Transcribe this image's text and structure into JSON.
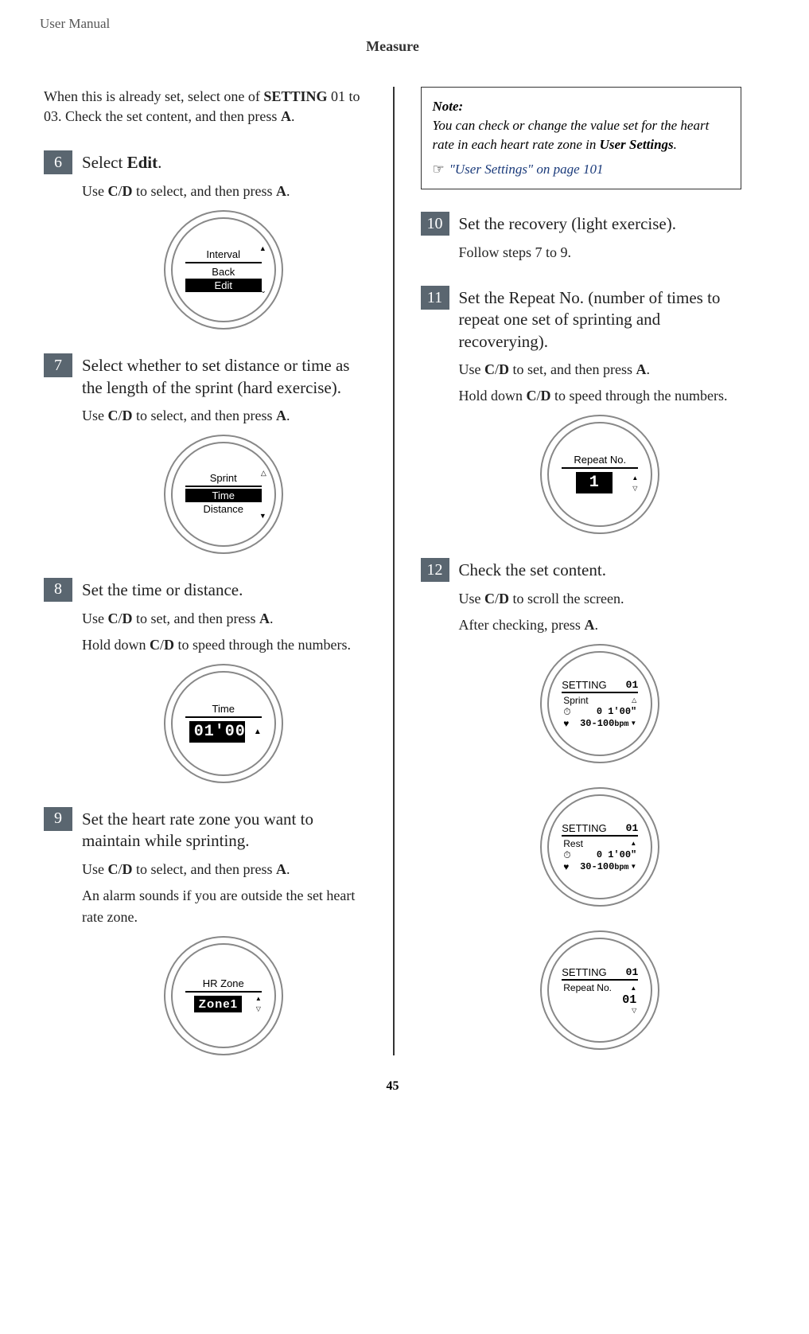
{
  "header": "User Manual",
  "section": "Measure",
  "page_number": "45",
  "intro": {
    "pre": "When this is already set, select one of ",
    "bold1": "SETTING",
    "mid": " 01 to 03. Check the set content, and then press ",
    "bold2": "A",
    "end": "."
  },
  "steps": {
    "s6": {
      "num": "6",
      "title_pre": "Select ",
      "title_bold": "Edit",
      "title_post": ".",
      "body1_pre": "Use ",
      "body1_b1": "C",
      "body1_slash": "/",
      "body1_b2": "D",
      "body1_mid": " to select, and then press ",
      "body1_b3": "A",
      "body1_end": "."
    },
    "s7": {
      "num": "7",
      "title": "Select whether to set distance or time as the length of the sprint (hard exercise).",
      "body1_pre": "Use ",
      "body1_b1": "C",
      "body1_slash": "/",
      "body1_b2": "D",
      "body1_mid": " to select, and then press ",
      "body1_b3": "A",
      "body1_end": "."
    },
    "s8": {
      "num": "8",
      "title": "Set the time or distance.",
      "body1_pre": "Use ",
      "body1_b1": "C",
      "body1_slash": "/",
      "body1_b2": "D",
      "body1_mid": " to set, and then press ",
      "body1_b3": "A",
      "body1_end": ".",
      "body2_pre": "Hold down ",
      "body2_b1": "C",
      "body2_slash": "/",
      "body2_b2": "D",
      "body2_end": " to speed through the numbers."
    },
    "s9": {
      "num": "9",
      "title": "Set the heart rate zone you want to maintain while sprinting.",
      "body1_pre": "Use ",
      "body1_b1": "C",
      "body1_slash": "/",
      "body1_b2": "D",
      "body1_mid": " to select, and then press ",
      "body1_b3": "A",
      "body1_end": ".",
      "body2": "An alarm sounds if you are outside the set heart rate zone."
    },
    "s10": {
      "num": "10",
      "title": "Set the recovery (light exercise).",
      "body1": "Follow steps 7 to 9."
    },
    "s11": {
      "num": "11",
      "title": "Set the Repeat No. (number of times to repeat one set of sprinting and recoverying).",
      "body1_pre": "Use ",
      "body1_b1": "C",
      "body1_slash": "/",
      "body1_b2": "D",
      "body1_mid": " to set, and then press ",
      "body1_b3": "A",
      "body1_end": ".",
      "body2_pre": "Hold down ",
      "body2_b1": "C",
      "body2_slash": "/",
      "body2_b2": "D",
      "body2_end": " to speed through the numbers."
    },
    "s12": {
      "num": "12",
      "title": "Check the set content.",
      "body1_pre": "Use ",
      "body1_b1": "C",
      "body1_slash": "/",
      "body1_b2": "D",
      "body1_end": " to scroll the screen.",
      "body2_pre": "After checking, press ",
      "body2_b1": "A",
      "body2_end": "."
    }
  },
  "note": {
    "label": "Note:",
    "body_pre": "You can check or change the value set for the heart rate in each heart rate zone in ",
    "body_bold": "User Settings",
    "body_post": ".",
    "hand": "☞",
    "link": "\"User Settings\" on page 101"
  },
  "watch": {
    "w6": {
      "top": "Interval",
      "l1": "Back",
      "l2": "Edit"
    },
    "w7": {
      "top": "Sprint",
      "l1": "Time",
      "l2": "Distance"
    },
    "w8": {
      "top": "Time",
      "value": "01'00\""
    },
    "w9": {
      "top": "HR Zone",
      "value": "Zone1"
    },
    "w11": {
      "top": "Repeat No.",
      "value": "1"
    },
    "w12a": {
      "top_l": "SETTING",
      "top_r": "01",
      "l1": "Sprint",
      "time": "0 1'00\"",
      "hr": "30-100",
      "bpm": "bpm"
    },
    "w12b": {
      "top_l": "SETTING",
      "top_r": "01",
      "l1": "Rest",
      "time": "0 1'00\"",
      "hr": "30-100",
      "bpm": "bpm"
    },
    "w12c": {
      "top_l": "SETTING",
      "top_r": "01",
      "l1": "Repeat No.",
      "val": "01"
    }
  }
}
